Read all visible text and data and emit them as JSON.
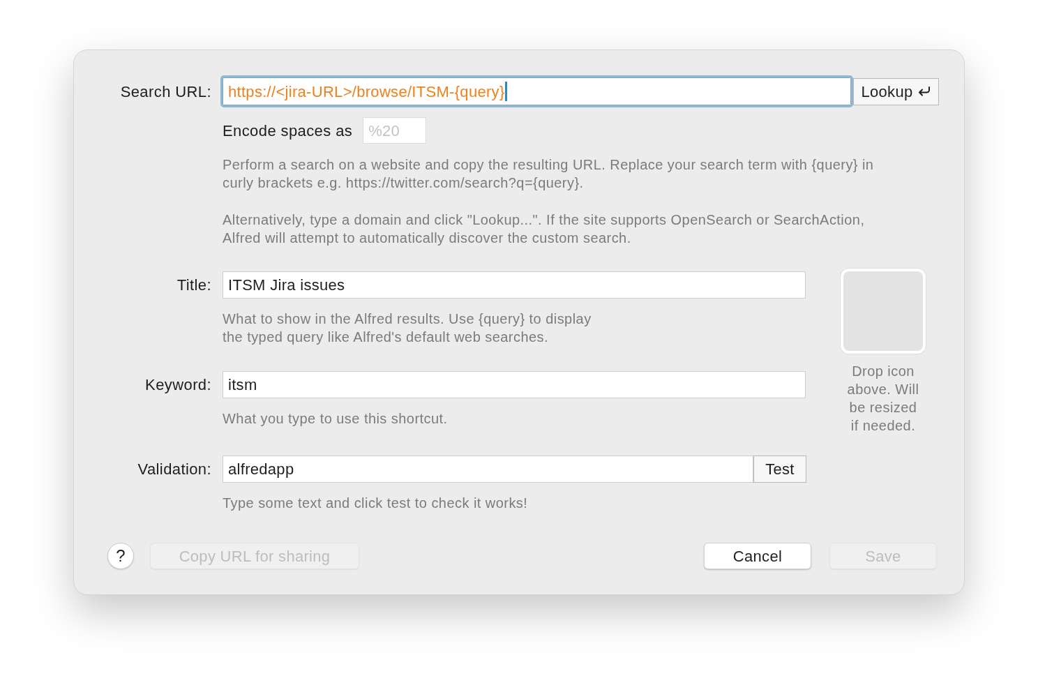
{
  "search_url": {
    "label": "Search URL:",
    "value": "https://<jira-URL>/browse/ITSM-{query}",
    "focused": true,
    "button": "Lookup"
  },
  "encode_spaces": {
    "label": "Encode spaces as",
    "placeholder": "%20"
  },
  "search_help": [
    [
      "Perform a search on a website and copy the resulting URL. Replace your search term with {query} in",
      "curly brackets e.g. https://twitter.com/search?q={query}."
    ],
    [
      "Alternatively, type a domain and click \"Lookup...\". If the site supports OpenSearch or SearchAction,",
      "Alfred will attempt to automatically discover the custom search."
    ]
  ],
  "title": {
    "label": "Title:",
    "value": "ITSM Jira issues",
    "focused": false,
    "help": [
      "What to show in the Alfred results. Use {query} to display",
      "the typed query like Alfred's default web searches."
    ]
  },
  "keyword": {
    "label": "Keyword:",
    "value": "itsm",
    "focused": false,
    "help": [
      "What you type to use this shortcut."
    ]
  },
  "validation": {
    "label": "Validation:",
    "value": "alfredapp",
    "focused": false,
    "button": "Test",
    "help": [
      "Type some text and click test to check it works!"
    ]
  },
  "icon_well": {
    "caption": [
      "Drop icon",
      "above. Will",
      "be resized",
      "if needed."
    ]
  },
  "footer": {
    "help_button": "?",
    "share_button": {
      "label": "Copy URL for sharing",
      "disabled": true
    },
    "buttons": [
      {
        "label": "Cancel",
        "disabled": false
      },
      {
        "label": "Save",
        "disabled": true
      }
    ]
  }
}
